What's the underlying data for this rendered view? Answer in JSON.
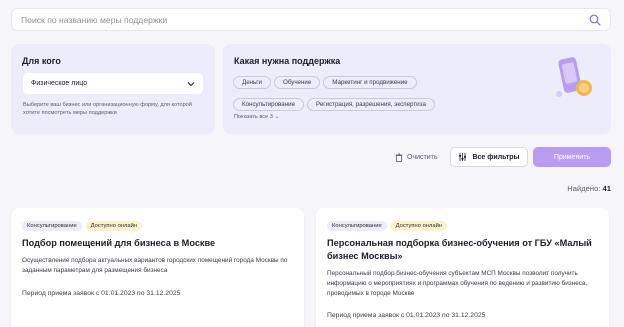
{
  "search": {
    "placeholder": "Поиск по названию меры поддержки",
    "icon": "search-icon"
  },
  "who": {
    "title": "Для кого",
    "selected": "Физическое лицо",
    "hint": "Выберите ваш бизнес или организационную форму, для которой хотите посмотреть меры поддержки"
  },
  "support": {
    "title": "Какая нужна поддержка",
    "chips": [
      "Деньги",
      "Обучение",
      "Маркетинг и продвижение",
      "Консультирование",
      "Регистрация, разрешения, экспертиза"
    ],
    "show_all": "Показать все 3 ⌄"
  },
  "actions": {
    "reset": "Очистить",
    "filters": "Все фильтры",
    "apply": "Применить"
  },
  "found": {
    "label": "Найдено:",
    "count": "41"
  },
  "cards": [
    {
      "type": "Консультирование",
      "status": "Доступно онлайн",
      "title": "Подбор помещений для бизнеса в Москве",
      "desc": "Осуществление подбора актуальных вариантов городских помещений города Москвы по заданным параметрам для размещения бизнеса",
      "period": "Период приема заявок с 01.01.2023 по 31.12.2025"
    },
    {
      "type": "Консультирование",
      "status": "Доступно онлайн",
      "title": "Персональная подборка бизнес-обучения от ГБУ «Малый бизнес Москвы»",
      "desc": "Персональный подбор бизнес-обучения субъектам МСП Москвы позволит получить информацию о мероприятиях и программах обучения по ведению и развитию бизнеса, проводимых в городе Москве",
      "period": "Период приема заявок с 01.01.2023 по 31.12.2025"
    }
  ],
  "colors": {
    "accent": "#b89df2",
    "panel": "#ececfb",
    "badge_online": "#fbf3c7"
  }
}
